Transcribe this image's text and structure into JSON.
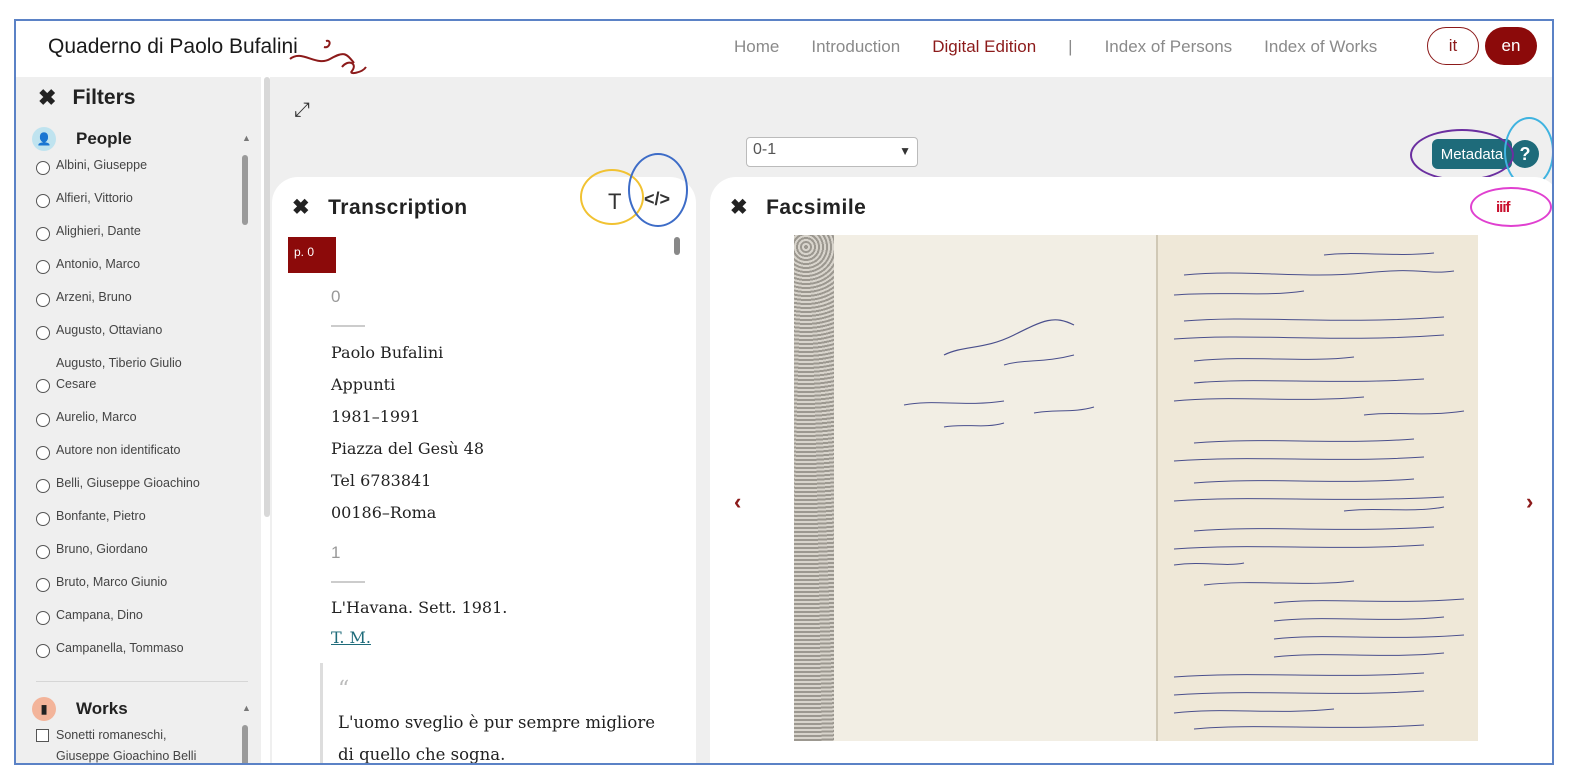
{
  "header": {
    "brand": "Quaderno di Paolo Bufalini",
    "nav": [
      "Home",
      "Introduction",
      "Digital Edition",
      "|",
      "Index of Persons",
      "Index of Works"
    ],
    "lang_it": "it",
    "lang_en": "en"
  },
  "sidebar": {
    "title": "Filters",
    "people_label": "People",
    "works_label": "Works",
    "people": [
      "Albini, Giuseppe",
      "Alfieri, Vittorio",
      "Alighieri, Dante",
      "Antonio, Marco",
      "Arzeni, Bruno",
      "Augusto, Ottaviano",
      "Augusto, Tiberio Giulio",
      "Cesare",
      "Aurelio, Marco",
      "Autore non identificato",
      "Belli, Giuseppe Gioachino",
      "Bonfante, Pietro",
      "Bruno, Giordano",
      "Bruto, Marco Giunio",
      "Campana, Dino",
      "Campanella, Tommaso"
    ],
    "works": [
      "Sonetti romaneschi,",
      "Giuseppe Gioachino Belli"
    ]
  },
  "toolbar": {
    "page_select": "0-1",
    "metadata": "Metadata",
    "help": "?"
  },
  "transcription": {
    "title": "Transcription",
    "page_tag": "p. 0",
    "num0": "0",
    "lines": [
      "Paolo Bufalini",
      "Appunti",
      "1981–1991",
      "Piazza del Gesù 48",
      "Tel 6783841",
      "00186–Roma"
    ],
    "num1": "1",
    "line_havana": "L'Havana. Sett. 1981.",
    "line_tm": "T. M.",
    "quote_mark": "“",
    "quote1": "L'uomo sveglio è pur sempre migliore",
    "quote2": "di quello che sogna."
  },
  "facsimile": {
    "title": "Facsimile",
    "iiif_label": "iiif"
  },
  "colors": {
    "brand_red": "#8c0a0a",
    "teal": "#1e6b7a",
    "frame_blue": "#5b82c6"
  }
}
